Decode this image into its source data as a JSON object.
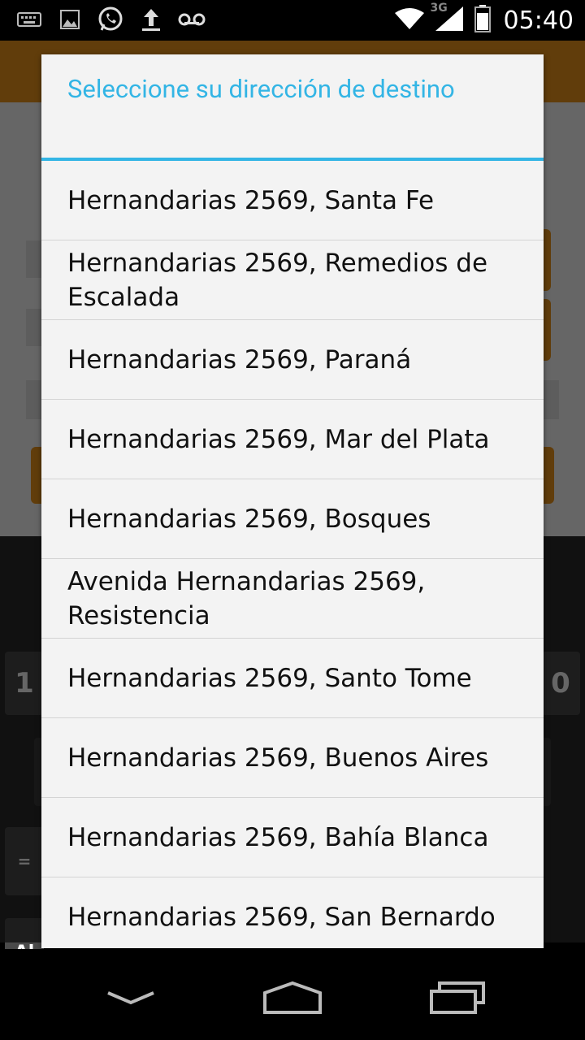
{
  "status_bar": {
    "time": "05:40",
    "network_label": "3G",
    "left_icons": [
      "keyboard-icon",
      "image-icon",
      "whatsapp-icon",
      "upload-icon",
      "voicemail-icon"
    ],
    "right_icons": [
      "wifi-icon",
      "signal-icon",
      "battery-icon"
    ]
  },
  "keyboard": {
    "key_1": "1",
    "key_0": "0",
    "key_eq": "=",
    "key_ab": "Al"
  },
  "dialog": {
    "title": "Seleccione su dirección de destino",
    "accent_color": "#33b5e5",
    "options": [
      {
        "label": "Hernandarias 2569, Santa Fe"
      },
      {
        "label": "Hernandarias 2569, Remedios de Escalada"
      },
      {
        "label": "Hernandarias 2569, Paraná"
      },
      {
        "label": "Hernandarias 2569, Mar del Plata"
      },
      {
        "label": "Hernandarias 2569, Bosques"
      },
      {
        "label": "Avenida Hernandarias 2569, Resistencia"
      },
      {
        "label": "Hernandarias 2569, Santo Tome"
      },
      {
        "label": "Hernandarias 2569, Buenos Aires"
      },
      {
        "label": "Hernandarias 2569, Bahía Blanca"
      },
      {
        "label": "Hernandarias 2569, San Bernardo"
      }
    ]
  },
  "nav_bar": {
    "buttons": [
      "back-icon",
      "home-icon",
      "recents-icon"
    ]
  }
}
